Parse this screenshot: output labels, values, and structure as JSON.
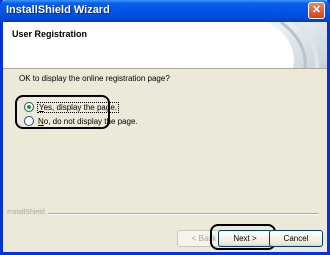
{
  "window": {
    "title": "InstallShield Wizard",
    "close_glyph": "✕"
  },
  "header": {
    "title": "User Registration"
  },
  "content": {
    "question": "OK to display the online registration page?",
    "options": [
      {
        "label": "Yes, display the page.",
        "selected": true
      },
      {
        "label": "No, do not display the page.",
        "selected": false
      }
    ]
  },
  "footer": {
    "brand": "InstallShield",
    "back_label": "< Back",
    "next_label": "Next >",
    "cancel_label": "Cancel"
  },
  "colors": {
    "titlebar": "#0055e5",
    "window_bg": "#ece9d8",
    "radio_dot": "#21a121"
  },
  "icons": [
    "close-icon",
    "wizard-header-graphic"
  ]
}
